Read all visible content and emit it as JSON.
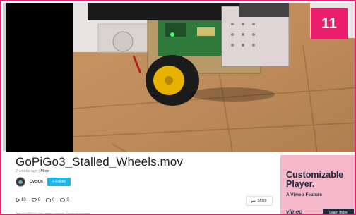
{
  "badge": {
    "number": "11"
  },
  "video": {
    "title": "GoPiGo3_Stalled_Wheels.mov",
    "posted": "2 weeks ago",
    "separator": "|",
    "more_link": "More",
    "author": "CyclOs",
    "follow_label": "+ Follow",
    "stats": {
      "plays": "10",
      "likes": "0",
      "collections": "0",
      "comments": "0"
    },
    "share_label": "Share",
    "description": "Test of GoPiGo3 Lean, stereo, sensors. For visual purposes."
  },
  "ad": {
    "headline_line1": "Customizable",
    "headline_line2": "Player.",
    "subline": "A Vimeo Feature",
    "logo": "vimeo",
    "cta": "Learn more"
  },
  "colors": {
    "accent": "#ec1e6e",
    "follow": "#1ab7ea",
    "ad_bg": "#f5b8cb",
    "ad_dark": "#1a2b3c"
  }
}
